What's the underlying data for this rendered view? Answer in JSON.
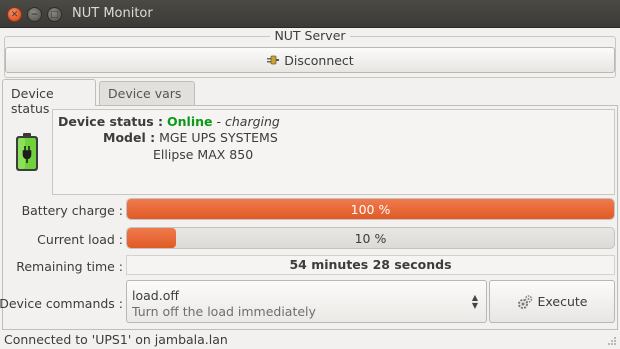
{
  "window": {
    "title": "NUT Monitor"
  },
  "server": {
    "frame_label": "NUT Server",
    "disconnect_label": "Disconnect"
  },
  "tabs": [
    {
      "label": "Device status"
    },
    {
      "label": "Device vars"
    }
  ],
  "device": {
    "status_key": "Device status :",
    "status_value": "Online",
    "status_sep": " - ",
    "status_detail": "charging",
    "model_key": "Model :",
    "model_line1": "MGE UPS SYSTEMS",
    "model_line2": "Ellipse MAX 850"
  },
  "battery_charge": {
    "label": "Battery charge :",
    "text": "100 %",
    "fraction": 1.0
  },
  "current_load": {
    "label": "Current load :",
    "text": "10 %",
    "fraction": 0.1
  },
  "remaining_time": {
    "label": "Remaining time :",
    "value": "54 minutes 28 seconds"
  },
  "commands": {
    "label": "Device commands :",
    "selected_name": "load.off",
    "selected_desc": "Turn off the load immediately",
    "execute_label": "Execute"
  },
  "statusbar": {
    "text": "Connected to 'UPS1' on jambala.lan"
  },
  "colors": {
    "online": "#0a9a16",
    "accent": "#e05a26"
  }
}
